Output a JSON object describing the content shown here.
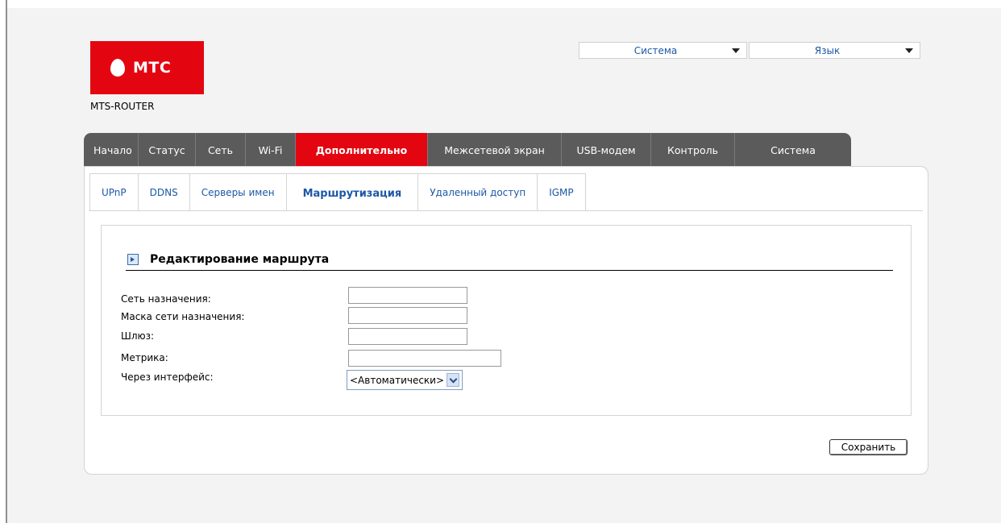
{
  "brand": {
    "logo_text": "МТС",
    "router_name": "MTS-ROUTER"
  },
  "top_dropdowns": {
    "system": "Система",
    "language": "Язык"
  },
  "main_menu": [
    {
      "label": "Начало"
    },
    {
      "label": "Статус"
    },
    {
      "label": "Сеть"
    },
    {
      "label": "Wi-Fi"
    },
    {
      "label": "Дополнительно",
      "active": true
    },
    {
      "label": "Межсетевой экран"
    },
    {
      "label": "USB-модем"
    },
    {
      "label": "Контроль"
    },
    {
      "label": "Система"
    }
  ],
  "sub_tabs": [
    {
      "label": "UPnP"
    },
    {
      "label": "DDNS"
    },
    {
      "label": "Серверы имен"
    },
    {
      "label": "Маршрутизация",
      "active": true
    },
    {
      "label": "Удаленный доступ"
    },
    {
      "label": "IGMP"
    }
  ],
  "section": {
    "title": "Редактирование маршрута"
  },
  "form": {
    "destination_network": {
      "label": "Сеть назначения:",
      "value": ""
    },
    "destination_mask": {
      "label": "Маска сети назначения:",
      "value": ""
    },
    "gateway": {
      "label": "Шлюз:",
      "value": ""
    },
    "metric": {
      "label": "Метрика:",
      "value": ""
    },
    "interface": {
      "label": "Через интерфейс:",
      "value": "<Автоматически>"
    }
  },
  "buttons": {
    "save": "Сохранить"
  },
  "colors": {
    "brand_red": "#e30611",
    "menu_gray": "#5b5b5b",
    "link_blue": "#1c58a6"
  }
}
